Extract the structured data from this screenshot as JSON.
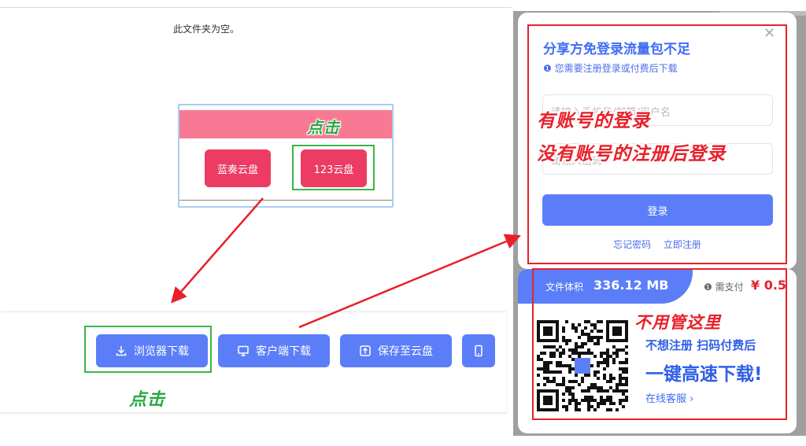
{
  "folder": {
    "empty_text": "此文件夹为空。"
  },
  "cloud_card": {
    "annotation": "点击",
    "buttons": [
      "蓝奏云盘",
      "123云盘"
    ]
  },
  "download_bar": {
    "browser_label": "浏览器下载",
    "client_label": "客户端下载",
    "save_label": "保存至云盘",
    "annotation": "点击"
  },
  "login": {
    "title": "分享方免登录流量包不足",
    "note": "您需要注册登录或付费后下载",
    "close_icon": "close-icon",
    "field1_placeholder": "请输入手机号/邮箱/用户名",
    "field2_placeholder": "请输入密码",
    "submit_label": "登录",
    "forgot_label": "忘记密码",
    "register_label": "立即注册",
    "annotation_line1": "有账号的登录",
    "annotation_line2": "没有账号的注册后登录"
  },
  "pay": {
    "size_label": "文件体积",
    "size_value": "336.12 MB",
    "need_label": "需支付",
    "price": "¥ 0.5",
    "line1": "不想注册 扫码付费后",
    "line2": "一键高速下载!",
    "service_label": "在线客服 ›",
    "annotation": "不用管这里"
  },
  "colors": {
    "accent": "#5b7ef8",
    "pink": "#ec3c63",
    "annotation_red": "#e8202a",
    "annotation_green": "#2aa845"
  }
}
